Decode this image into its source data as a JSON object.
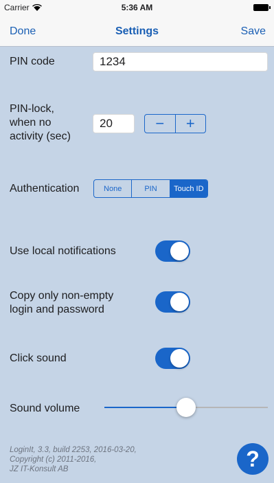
{
  "status_bar": {
    "carrier": "Carrier",
    "time": "5:36 AM",
    "wifi_icon": "wifi-icon",
    "battery_icon": "battery-icon"
  },
  "nav": {
    "left_label": "Done",
    "title": "Settings",
    "right_label": "Save"
  },
  "pin": {
    "label": "PIN code",
    "value": "1234"
  },
  "pin_lock": {
    "label_line1": "PIN-lock,",
    "label_line2": "when no",
    "label_line3": "activity (sec)",
    "value": "20",
    "minus": "−",
    "plus": "+"
  },
  "authentication": {
    "label": "Authentication",
    "options": [
      "None",
      "PIN",
      "Touch ID"
    ],
    "selected": "Touch ID"
  },
  "local_notifications": {
    "label": "Use local notifications",
    "on": true
  },
  "copy_non_empty": {
    "label_line1": "Copy only non-empty",
    "label_line2": "login and password",
    "on": true
  },
  "click_sound": {
    "label": "Click sound",
    "on": true
  },
  "sound_volume": {
    "label": "Sound volume",
    "value": 0.5
  },
  "footer": {
    "line1": "LoginIt, 3.3, build 2253, 2016-03-20,",
    "line2": "Copyright (c) 2011-2016,",
    "line3": "JZ IT-Konsult AB"
  },
  "help": {
    "label": "?"
  },
  "colors": {
    "background": "#c5d4e6",
    "accent": "#1a66c9",
    "bar": "#f7f7f7"
  }
}
